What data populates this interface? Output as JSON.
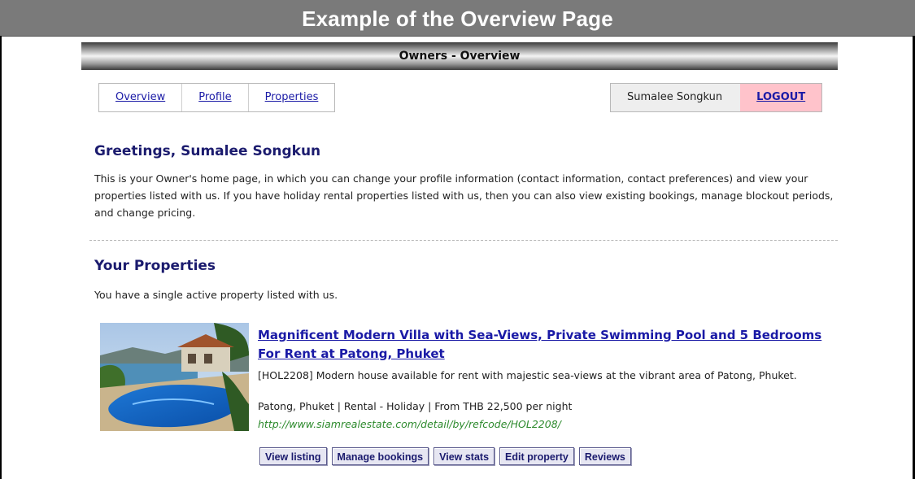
{
  "banner": {
    "title": "Example of the Overview Page"
  },
  "header": {
    "title": "Owners - Overview"
  },
  "nav": {
    "items": [
      "Overview",
      "Profile",
      "Properties"
    ]
  },
  "user": {
    "name": "Sumalee Songkun",
    "logout_label": "LOGOUT"
  },
  "greeting": "Greetings, Sumalee Songkun",
  "intro": "This is your Owner's home page, in which you can change your profile information (contact information, contact preferences) and view your properties listed with us. If you have holiday rental properties listed with us, then you can also view existing bookings, manage blockout periods, and change pricing.",
  "properties": {
    "heading": "Your Properties",
    "summary": "You have a single active property listed with us.",
    "listing": {
      "title": "Magnificent Modern Villa with Sea-Views, Private Swimming Pool and 5 Bedrooms For Rent at Patong, Phuket",
      "description": "[HOL2208] Modern house available for rent with majestic sea-views at the vibrant area of Patong, Phuket.",
      "meta": "Patong, Phuket | Rental - Holiday | From THB 22,500 per night",
      "url": "http://www.siamrealestate.com/detail/by/refcode/HOL2208/"
    },
    "actions": [
      "View listing",
      "Manage bookings",
      "View stats",
      "Edit property",
      "Reviews"
    ]
  }
}
